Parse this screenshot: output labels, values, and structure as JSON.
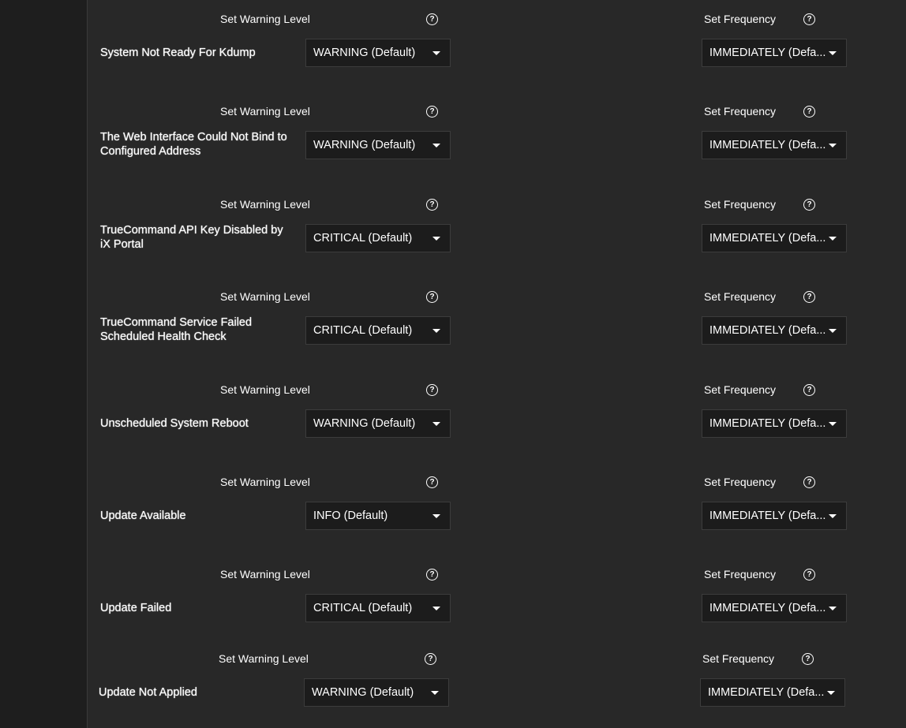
{
  "labels": {
    "warning_level": "Set Warning Level",
    "frequency": "Set Frequency"
  },
  "alerts": [
    {
      "name": "System Not Ready For Kdump",
      "level": "WARNING (Default)",
      "frequency": "IMMEDIATELY (Defa..."
    },
    {
      "name": "The Web Interface Could Not Bind to Configured Address",
      "level": "WARNING (Default)",
      "frequency": "IMMEDIATELY (Defa..."
    },
    {
      "name": "TrueCommand API Key Disabled by iX Portal",
      "level": "CRITICAL (Default)",
      "frequency": "IMMEDIATELY (Defa..."
    },
    {
      "name": "TrueCommand Service Failed Scheduled Health Check",
      "level": "CRITICAL (Default)",
      "frequency": "IMMEDIATELY (Defa..."
    },
    {
      "name": "Unscheduled System Reboot",
      "level": "WARNING (Default)",
      "frequency": "IMMEDIATELY (Defa..."
    },
    {
      "name": "Update Available",
      "level": "INFO (Default)",
      "frequency": "IMMEDIATELY (Defa..."
    },
    {
      "name": "Update Failed",
      "level": "CRITICAL (Default)",
      "frequency": "IMMEDIATELY (Defa..."
    },
    {
      "name": "Update Not Applied",
      "level": "WARNING (Default)",
      "frequency": "IMMEDIATELY (Defa..."
    }
  ]
}
